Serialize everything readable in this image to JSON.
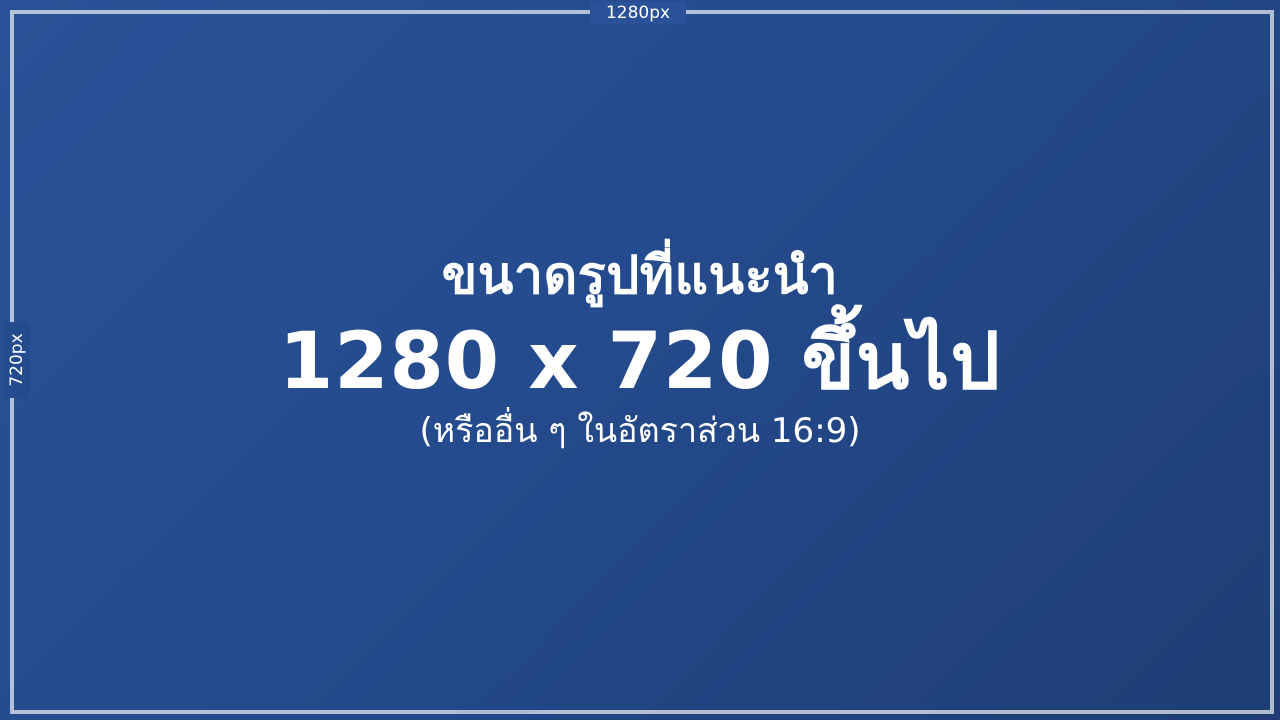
{
  "canvas": {
    "width_label": "1280px",
    "height_label": "720px",
    "frame_color": "#ffffff",
    "background_colors": [
      "#2a5298",
      "#1f3d74"
    ]
  },
  "message": {
    "headline": "ขนาดรูปที่แนะนำ",
    "size": "1280 x 720 ขึ้นไป",
    "note": "(หรืออื่น ๆ ในอัตราส่วน 16:9)"
  }
}
